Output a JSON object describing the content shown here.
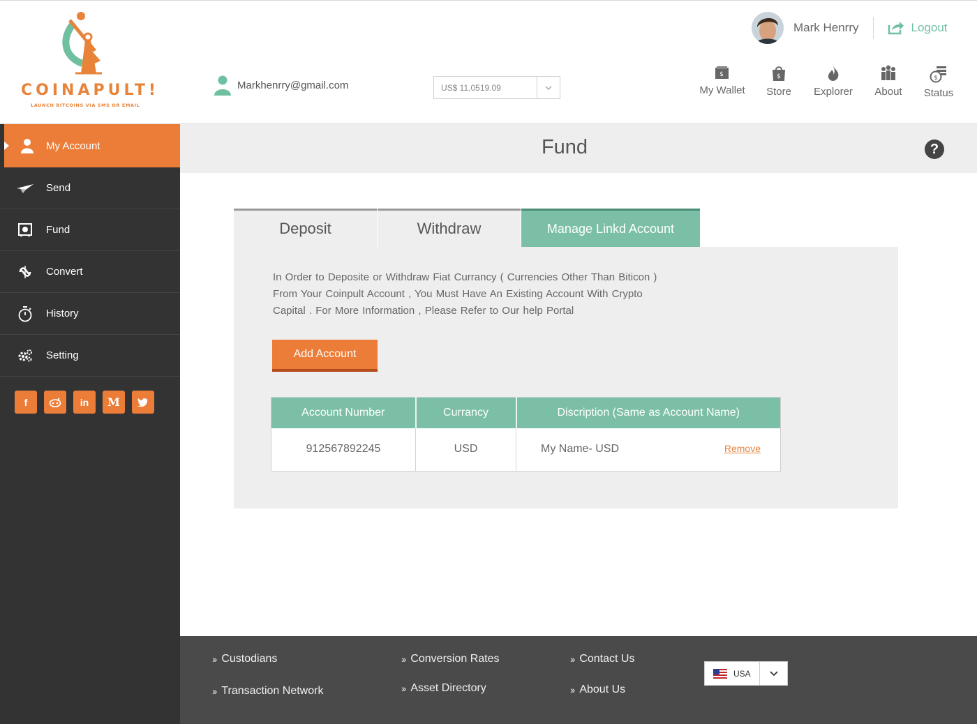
{
  "brand": {
    "name": "COINAPULT!",
    "tagline": "LAUNCH BITCOINS VIA SMS OR EMAIL",
    "accent": "#ec7d38",
    "teal": "#7bbfa6"
  },
  "header": {
    "email": "Markhenrry@gmail.com",
    "balance": "US$ 11,0519.09",
    "user_name": "Mark Henrry",
    "logout_label": "Logout",
    "nav": [
      {
        "label": "My Wallet",
        "icon": "wallet-icon"
      },
      {
        "label": "Store",
        "icon": "store-bag-icon"
      },
      {
        "label": "Explorer",
        "icon": "flame-icon"
      },
      {
        "label": "About",
        "icon": "people-icon"
      },
      {
        "label": "Status",
        "icon": "coin-stack-icon"
      }
    ]
  },
  "sidebar": {
    "items": [
      {
        "label": "My Account",
        "icon": "user-icon",
        "active": true
      },
      {
        "label": "Send",
        "icon": "paper-plane-icon"
      },
      {
        "label": "Fund",
        "icon": "safe-icon"
      },
      {
        "label": "Convert",
        "icon": "convert-icon"
      },
      {
        "label": "History",
        "icon": "stopwatch-icon"
      },
      {
        "label": "Setting",
        "icon": "gears-icon"
      }
    ],
    "social": [
      "f",
      "in",
      "M"
    ]
  },
  "main": {
    "title": "Fund",
    "tabs": [
      {
        "label": "Deposit"
      },
      {
        "label": "Withdraw"
      },
      {
        "label": "Manage Linkd Account",
        "active": true
      }
    ],
    "info_lines": [
      "In Order to Deposite or Withdraw Fiat Currancy ( Currencies Other  Than Biticon )",
      "From Your Coinpult Account , You  Must  Have An  Existing  Account With  Crypto",
      "Capital . For  More  Information , Please  Refer  to Our help Portal"
    ],
    "add_account_label": "Add Account",
    "table": {
      "headers": [
        "Account Number",
        "Currancy",
        "Discription (Same as Account Name)"
      ],
      "rows": [
        {
          "account": "912567892245",
          "currency": "USD",
          "description": "My Name- USD",
          "action": "Remove"
        }
      ]
    }
  },
  "footer": {
    "links": [
      [
        "Custodians",
        "Transaction Network"
      ],
      [
        "Conversion Rates",
        "Asset Directory"
      ],
      [
        "Contact Us",
        "About Us"
      ]
    ],
    "country": "USA"
  }
}
